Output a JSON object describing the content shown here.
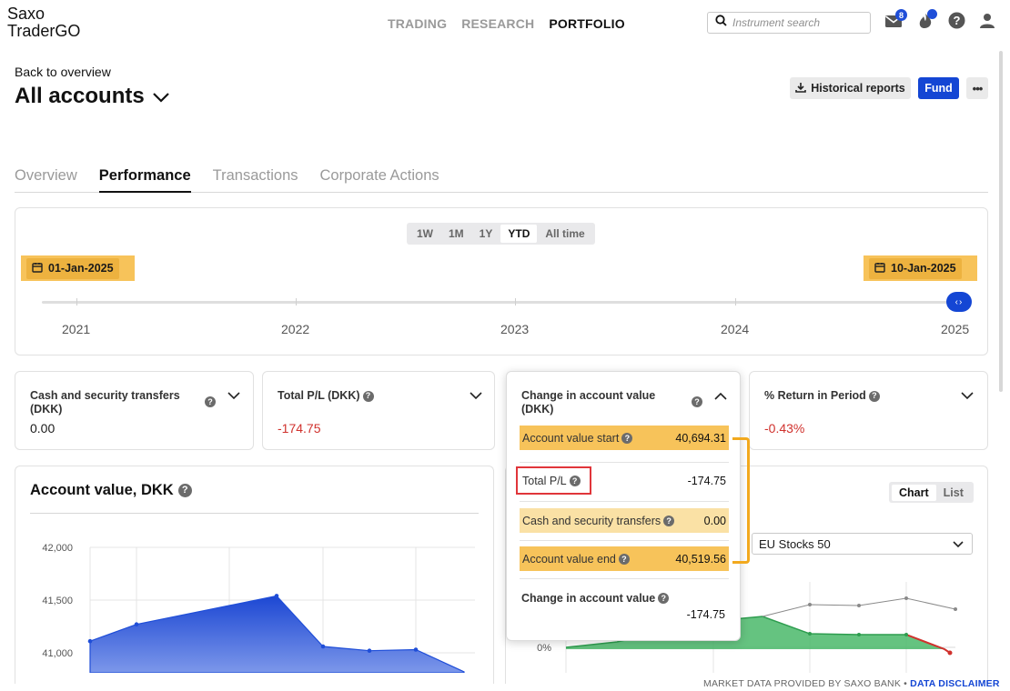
{
  "brand": {
    "line1": "Saxo",
    "line2": "TraderGO"
  },
  "nav": {
    "trading": "TRADING",
    "research": "RESEARCH",
    "portfolio": "PORTFOLIO"
  },
  "search": {
    "placeholder": "Instrument search"
  },
  "mail": {
    "badge": "8"
  },
  "header": {
    "back": "Back to overview",
    "title": "All accounts",
    "historical": "Historical reports",
    "fund": "Fund"
  },
  "tabs": {
    "overview": "Overview",
    "performance": "Performance",
    "transactions": "Transactions",
    "corporate": "Corporate Actions"
  },
  "period": {
    "options": [
      "1W",
      "1M",
      "1Y",
      "YTD",
      "All time"
    ],
    "selected": "YTD",
    "start": "01-Jan-2025",
    "end": "10-Jan-2025",
    "years": [
      "2021",
      "2022",
      "2023",
      "2024",
      "2025"
    ]
  },
  "kpis": {
    "transfers": {
      "label1": "Cash and security transfers",
      "label2": "(DKK)",
      "value": "0.00"
    },
    "pl": {
      "label": "Total P/L (DKK)",
      "value": "-174.75"
    },
    "change": {
      "label1": "Change in account value",
      "label2": "(DKK)"
    },
    "ret": {
      "label": "% Return in Period",
      "value": "-0.43%"
    }
  },
  "popup": {
    "start_label": "Account value start",
    "start_value": "40,694.31",
    "pl_label": "Total P/L",
    "pl_value": "-174.75",
    "transfers_label": "Cash and security transfers",
    "transfers_value": "0.00",
    "end_label": "Account value end",
    "end_value": "40,519.56",
    "change_label": "Change in account value",
    "change_value": "-174.75"
  },
  "account_chart": {
    "title": "Account value, DKK"
  },
  "chart_data": {
    "type": "area",
    "title": "Account value, DKK",
    "yticks": [
      "42,000",
      "41,500",
      "41,000"
    ],
    "ylim": [
      40800,
      42100
    ],
    "values": [
      41110,
      41270,
      41540,
      41060,
      41020,
      41030,
      40820
    ]
  },
  "return_chart": {
    "chart": "Chart",
    "list": "List",
    "benchmark": "EU Stocks 50",
    "zero_label": "0%"
  },
  "footer": {
    "text": "MARKET DATA PROVIDED BY SAXO BANK • ",
    "link": "DATA DISCLAIMER"
  },
  "colors": {
    "accent": "#1446d4",
    "highlight": "#f7c35a",
    "negative": "#d0312d",
    "positive": "#2e9d4f"
  }
}
